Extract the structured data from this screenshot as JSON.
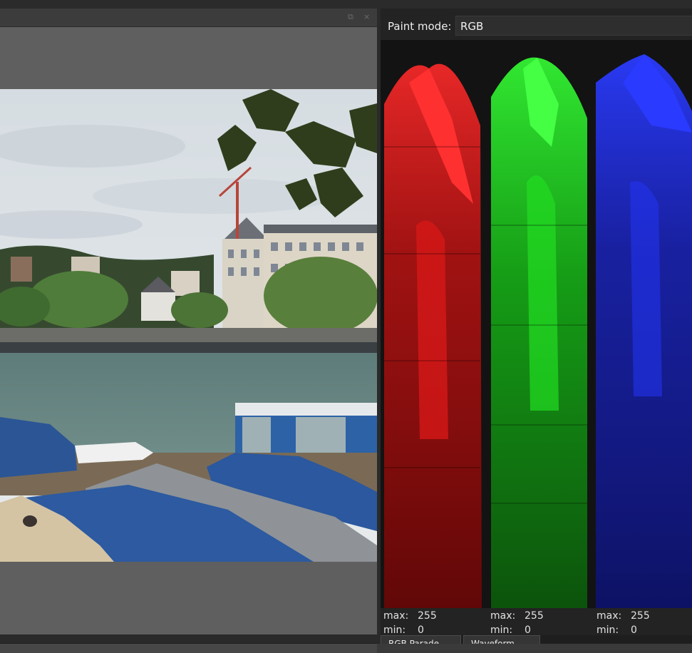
{
  "canvas": {
    "float_icon": "⧉",
    "close_icon": "×"
  },
  "docker": {
    "paint_mode_label": "Paint mode:",
    "paint_mode_value": "RGB",
    "channels": [
      {
        "name": "red",
        "color": "#ff2020",
        "max_label": "max:",
        "max": "255",
        "min_label": "min:",
        "min": "0"
      },
      {
        "name": "green",
        "color": "#20ff20",
        "max_label": "max:",
        "max": "255",
        "min_label": "min:",
        "min": "0"
      },
      {
        "name": "blue",
        "color": "#2030ff",
        "max_label": "max:",
        "max": "255",
        "min_label": "min:",
        "min": "0"
      }
    ],
    "tabs": [
      "RGB Parade",
      "Waveform"
    ]
  }
}
